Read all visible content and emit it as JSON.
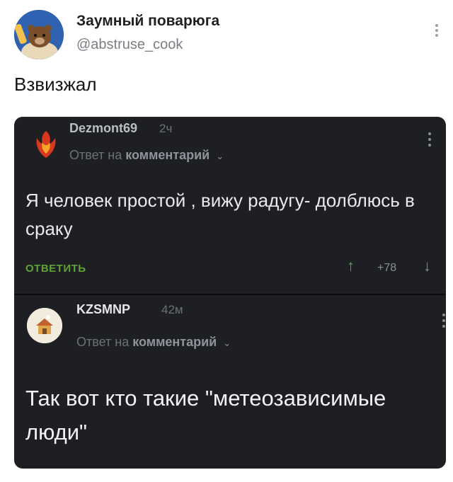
{
  "tweet": {
    "author_name": "Заумный поварюга",
    "author_handle": "@abstruse_cook",
    "text": "Взвизжал",
    "avatar_icon": "bear-chef-avatar",
    "menu_icon": "more-vert-icon"
  },
  "embed": {
    "comments": [
      {
        "author": "Dezmont69",
        "time": "2ч",
        "reply_prefix": "Ответ на",
        "reply_target": "комментарий",
        "text": "Я человек простой , вижу радугу- долблюсь в сраку",
        "reply_button": "ОТВЕТИТЬ",
        "vote_up": "↑",
        "score": "+78",
        "vote_down": "↓",
        "avatar_icon": "phoenix-avatar"
      },
      {
        "author": "KZSMNP",
        "time": "42м",
        "reply_prefix": "Ответ на",
        "reply_target": "комментарий",
        "text": "Так вот кто такие \"метеозависимые люди\"",
        "avatar_icon": "house-avatar"
      }
    ]
  },
  "colors": {
    "embed_bg": "#1e1f23",
    "reply_green": "#5fa334",
    "vote_up_green": "#4caf50"
  }
}
